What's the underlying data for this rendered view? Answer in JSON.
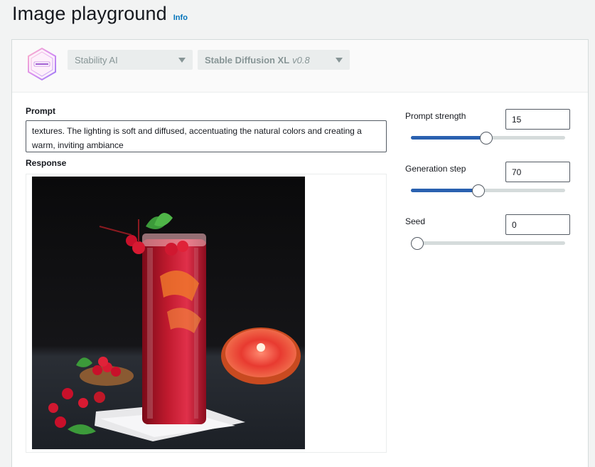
{
  "header": {
    "title": "Image playground",
    "info_label": "Info"
  },
  "model_select": {
    "provider": "Stability AI",
    "model_name": "Stable Diffusion XL",
    "model_version": "v0.8",
    "logo_icon": "stability-ai-logo-icon"
  },
  "prompt": {
    "label": "Prompt",
    "value": "textures. The lighting is soft and diffused, accentuating the natural colors and creating a warm, inviting ambiance"
  },
  "response": {
    "label": "Response",
    "image_icon": "generated-cocktail-image"
  },
  "params": {
    "prompt_strength": {
      "label": "Prompt strength",
      "value": "15",
      "fraction": 0.49
    },
    "generation_step": {
      "label": "Generation step",
      "value": "70",
      "fraction": 0.44
    },
    "seed": {
      "label": "Seed",
      "value": "0",
      "fraction": 0.0
    }
  },
  "colors": {
    "accent": "#0073bb",
    "slider_fill": "#2a61b0",
    "background": "#f2f3f3"
  }
}
